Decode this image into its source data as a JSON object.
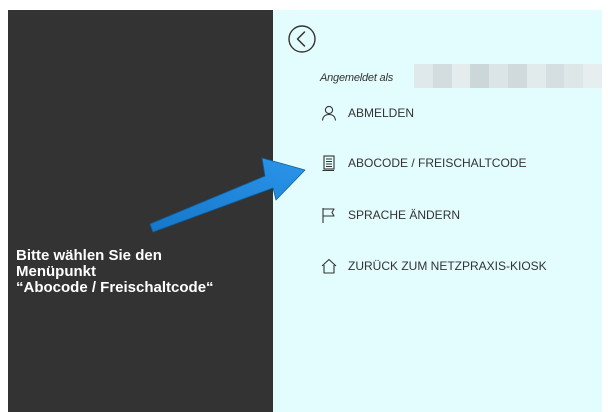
{
  "instruction": {
    "lines": [
      "Bitte wählen Sie den",
      "Menüpunkt",
      "“Abocode / Freischaltcode“"
    ]
  },
  "menu": {
    "back_icon": "back-circle-chevron-icon",
    "logged_in_label": "Angemeldet als",
    "items": [
      {
        "label": "ABMELDEN",
        "icon": "user-icon"
      },
      {
        "label": "ABOCODE / FREISCHALTCODE",
        "icon": "document-list-icon"
      },
      {
        "label": "SPRACHE ÄNDERN",
        "icon": "flag-icon"
      },
      {
        "label": "ZURÜCK ZUM NETZPRAXIS-KIOSK",
        "icon": "home-icon"
      }
    ]
  },
  "colors": {
    "left_panel": "#333333",
    "right_panel": "#e3fcfd",
    "arrow": "#1a84de",
    "text": "#333333"
  }
}
